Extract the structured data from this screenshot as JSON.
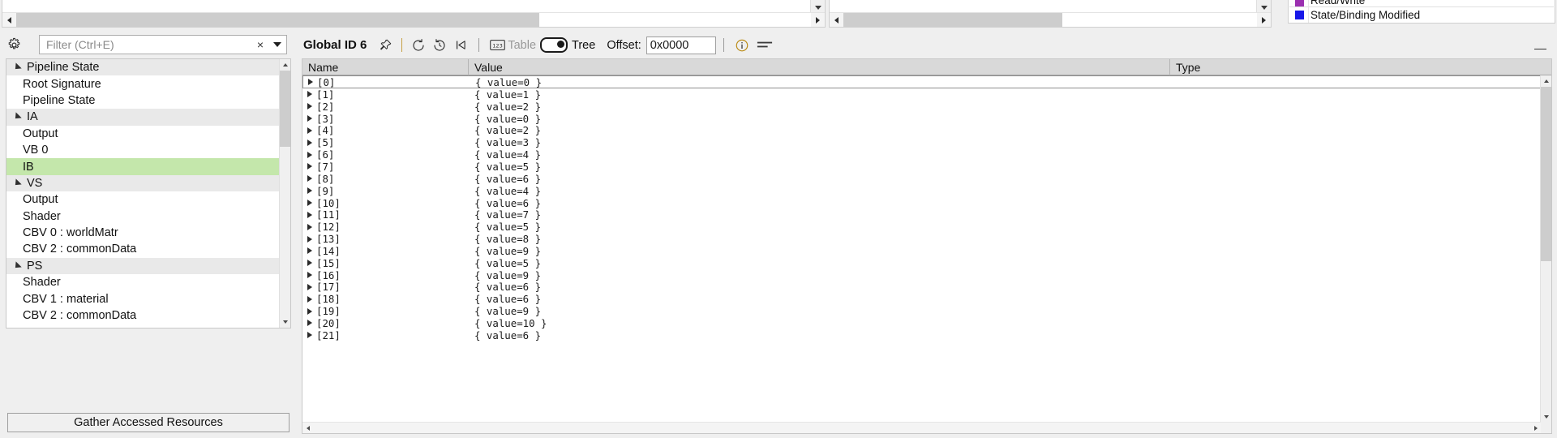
{
  "legend": {
    "clipped_item": {
      "label": "Read/Write",
      "color": "#9b30b0"
    },
    "visible_item": {
      "label": "State/Binding Modified",
      "color": "#1717e8"
    }
  },
  "left_panel": {
    "gear_icon": "gear-icon",
    "filter": {
      "placeholder": "Filter (Ctrl+E)",
      "value": "",
      "clear_glyph": "×",
      "dropdown_glyph": "▼"
    },
    "tree": [
      {
        "label": "Pipeline State",
        "type": "group",
        "expanded": true,
        "selected": false
      },
      {
        "label": "Root Signature",
        "type": "leaf",
        "expanded": false,
        "selected": false
      },
      {
        "label": "Pipeline State",
        "type": "leaf",
        "expanded": false,
        "selected": false
      },
      {
        "label": "IA",
        "type": "group",
        "expanded": true,
        "selected": false
      },
      {
        "label": "Output",
        "type": "leaf",
        "expanded": false,
        "selected": false
      },
      {
        "label": "VB 0",
        "type": "leaf",
        "expanded": false,
        "selected": false
      },
      {
        "label": "IB",
        "type": "leaf",
        "expanded": false,
        "selected": true
      },
      {
        "label": "VS",
        "type": "group",
        "expanded": true,
        "selected": false
      },
      {
        "label": "Output",
        "type": "leaf",
        "expanded": false,
        "selected": false
      },
      {
        "label": "Shader",
        "type": "leaf",
        "expanded": false,
        "selected": false
      },
      {
        "label": "CBV 0 : worldMatr",
        "type": "leaf",
        "expanded": false,
        "selected": false
      },
      {
        "label": "CBV 2 : commonData",
        "type": "leaf",
        "expanded": false,
        "selected": false
      },
      {
        "label": "PS",
        "type": "group",
        "expanded": true,
        "selected": false
      },
      {
        "label": "Shader",
        "type": "leaf",
        "expanded": false,
        "selected": false
      },
      {
        "label": "CBV 1 : material",
        "type": "leaf",
        "expanded": false,
        "selected": false
      },
      {
        "label": "CBV 2 : commonData",
        "type": "leaf",
        "expanded": false,
        "selected": false
      }
    ],
    "gather_button": "Gather Accessed Resources"
  },
  "right_panel": {
    "title": "Global ID 6",
    "toolbar_icons": [
      "pin-icon",
      "refresh-icon",
      "history-icon",
      "go-to-first-icon",
      "numeric-format-icon",
      "info-icon",
      "column-options-icon"
    ],
    "view_toggle": {
      "left_label": "Table",
      "right_label": "Tree",
      "selected": "Tree"
    },
    "offset": {
      "label": "Offset:",
      "value": "0x0000"
    },
    "minimize_glyph": "minimize-icon",
    "grid": {
      "columns": [
        "Name",
        "Value",
        "Type"
      ],
      "rows": [
        {
          "name": "[0]",
          "value": "{ value=0  }",
          "type": ""
        },
        {
          "name": "[1]",
          "value": "{ value=1  }",
          "type": ""
        },
        {
          "name": "[2]",
          "value": "{ value=2  }",
          "type": ""
        },
        {
          "name": "[3]",
          "value": "{ value=0  }",
          "type": ""
        },
        {
          "name": "[4]",
          "value": "{ value=2  }",
          "type": ""
        },
        {
          "name": "[5]",
          "value": "{ value=3  }",
          "type": ""
        },
        {
          "name": "[6]",
          "value": "{ value=4  }",
          "type": ""
        },
        {
          "name": "[7]",
          "value": "{ value=5  }",
          "type": ""
        },
        {
          "name": "[8]",
          "value": "{ value=6  }",
          "type": ""
        },
        {
          "name": "[9]",
          "value": "{ value=4  }",
          "type": ""
        },
        {
          "name": "[10]",
          "value": "{ value=6  }",
          "type": ""
        },
        {
          "name": "[11]",
          "value": "{ value=7  }",
          "type": ""
        },
        {
          "name": "[12]",
          "value": "{ value=5  }",
          "type": ""
        },
        {
          "name": "[13]",
          "value": "{ value=8  }",
          "type": ""
        },
        {
          "name": "[14]",
          "value": "{ value=9  }",
          "type": ""
        },
        {
          "name": "[15]",
          "value": "{ value=5  }",
          "type": ""
        },
        {
          "name": "[16]",
          "value": "{ value=9  }",
          "type": ""
        },
        {
          "name": "[17]",
          "value": "{ value=6  }",
          "type": ""
        },
        {
          "name": "[18]",
          "value": "{ value=6  }",
          "type": ""
        },
        {
          "name": "[19]",
          "value": "{ value=9  }",
          "type": ""
        },
        {
          "name": "[20]",
          "value": "{ value=10 }",
          "type": ""
        },
        {
          "name": "[21]",
          "value": "{ value=6  }",
          "type": ""
        }
      ],
      "focused_row_index": 0
    }
  }
}
